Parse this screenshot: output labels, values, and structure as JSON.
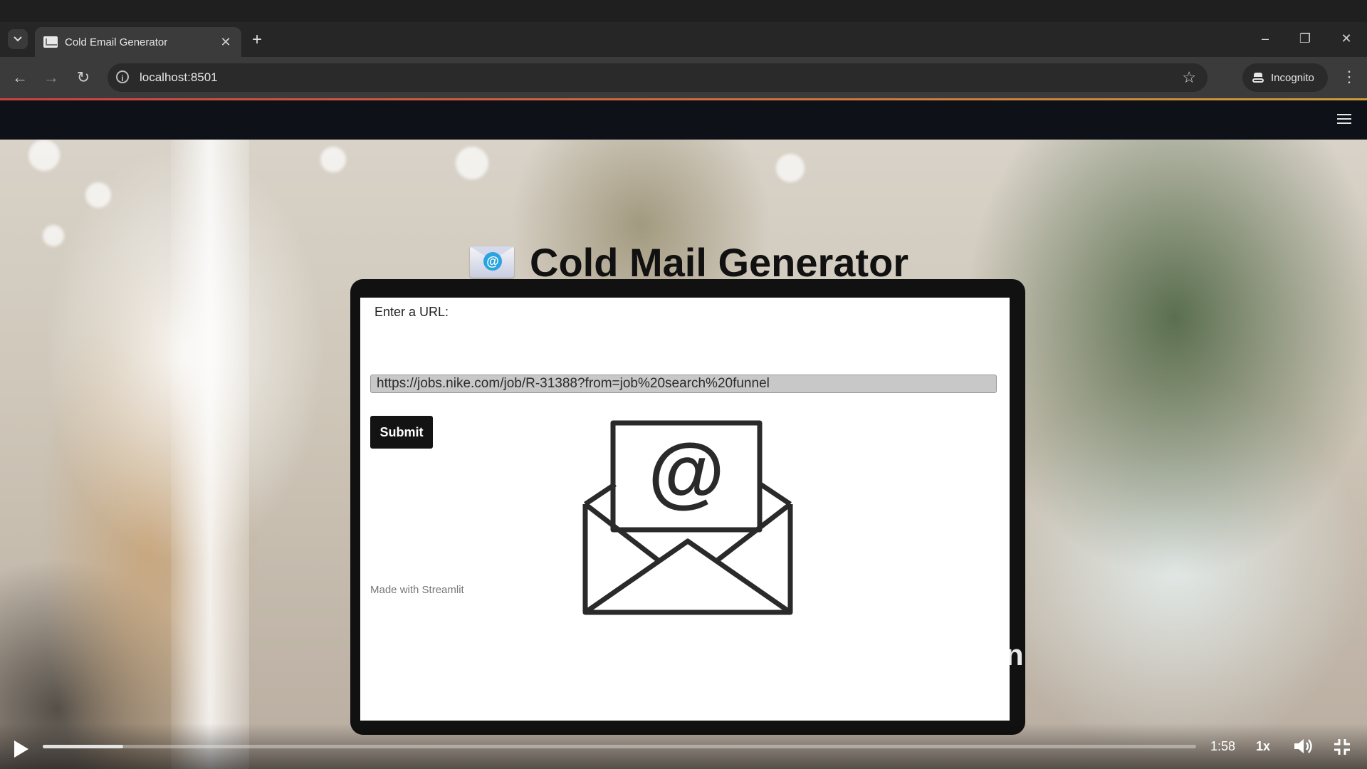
{
  "browser": {
    "tab_title": "Cold Email Generator",
    "tab_close": "✕",
    "new_tab": "+",
    "url": "localhost:8501",
    "incognito_label": "Incognito",
    "window_controls": {
      "minimize": "–",
      "restore": "❐",
      "close": "✕"
    },
    "nav": {
      "back": "←",
      "forward": "→",
      "reload": "↻"
    }
  },
  "app": {
    "title": "Cold Mail Generator",
    "title_icon": "email-at-icon",
    "input_label": "Enter a URL:",
    "url_value": "https://jobs.nike.com/job/R-31388?from=job%20search%20funnel",
    "submit_label": "Submit",
    "footer": "Made with Streamlit",
    "overlay_fragment": "n"
  },
  "player": {
    "time": "1:58",
    "speed": "1x",
    "progress": 0.07
  },
  "colors": {
    "accent_gradient_start": "#ff4b4b",
    "accent_gradient_end": "#ffbd45",
    "header_bg": "#0e1117"
  }
}
